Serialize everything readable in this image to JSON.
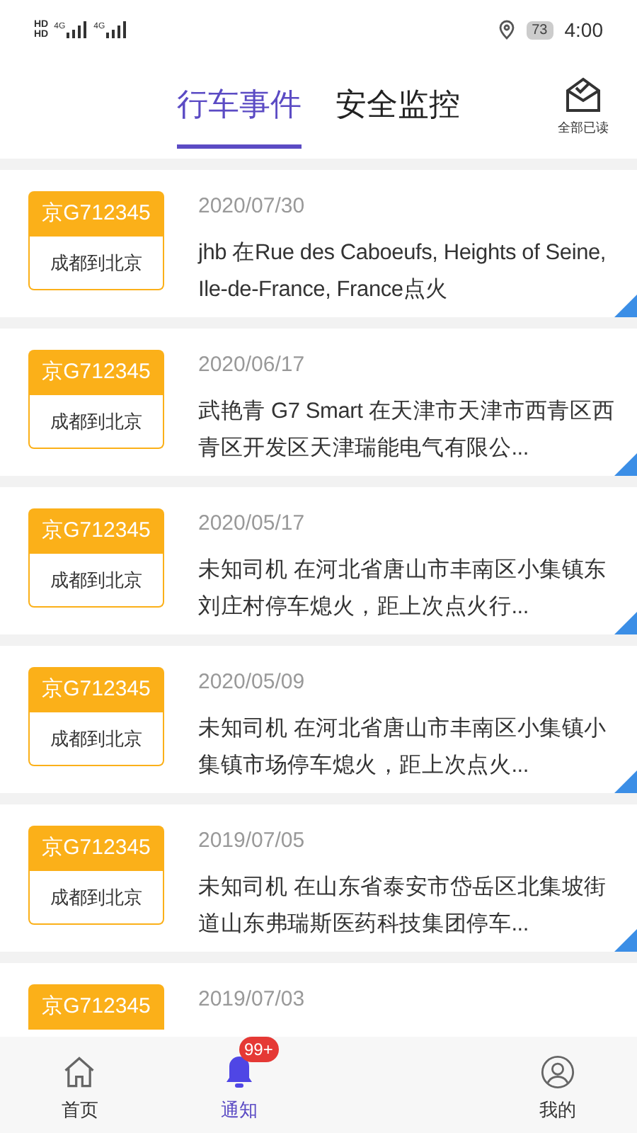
{
  "status_bar": {
    "network_labels": [
      "HD",
      "HD",
      "4G",
      "4G"
    ],
    "battery": "73",
    "time": "4:00"
  },
  "tabs": [
    {
      "label": "行车事件",
      "selected": true
    },
    {
      "label": "安全监控",
      "selected": false
    }
  ],
  "mark_all_read": "全部已读",
  "events": [
    {
      "plate": "京G712345",
      "route": "成都到北京",
      "date": "2020/07/30",
      "text": "jhb 在Rue des Caboeufs, Heights of Seine, Ile-de-France, France点火"
    },
    {
      "plate": "京G712345",
      "route": "成都到北京",
      "date": "2020/06/17",
      "text": "武艳青 G7 Smart 在天津市天津市西青区西青区开发区天津瑞能电气有限公..."
    },
    {
      "plate": "京G712345",
      "route": "成都到北京",
      "date": "2020/05/17",
      "text": "未知司机 在河北省唐山市丰南区小集镇东刘庄村停车熄火，距上次点火行..."
    },
    {
      "plate": "京G712345",
      "route": "成都到北京",
      "date": "2020/05/09",
      "text": "未知司机 在河北省唐山市丰南区小集镇小集镇市场停车熄火，距上次点火..."
    },
    {
      "plate": "京G712345",
      "route": "成都到北京",
      "date": "2019/07/05",
      "text": "未知司机 在山东省泰安市岱岳区北集坡街道山东弗瑞斯医药科技集团停车..."
    },
    {
      "plate": "京G712345",
      "date": "2019/07/03"
    }
  ],
  "nav": [
    {
      "kind": "home",
      "label": "首页",
      "selected": false
    },
    {
      "kind": "bell",
      "label": "通知",
      "selected": true,
      "badge": "99+"
    },
    {
      "kind": "hidden"
    },
    {
      "kind": "user",
      "label": "我的",
      "selected": false
    }
  ]
}
